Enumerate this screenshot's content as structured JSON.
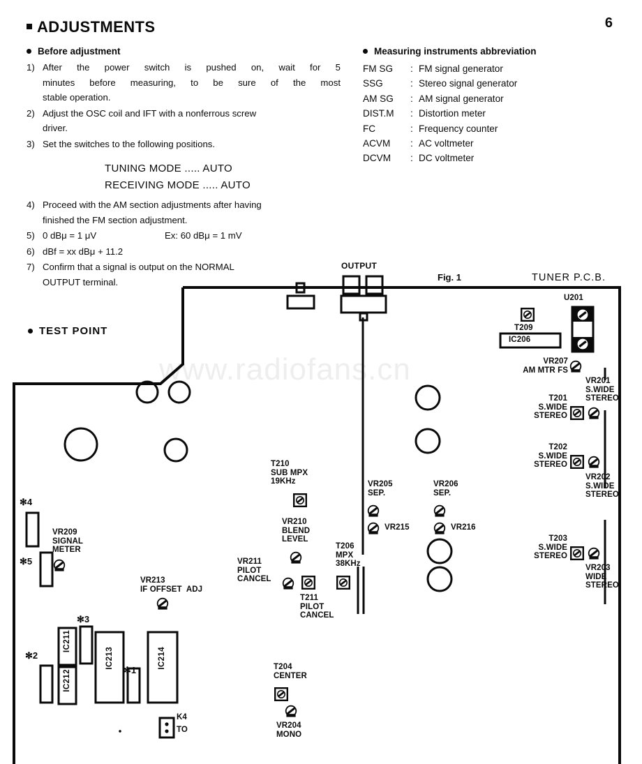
{
  "page": {
    "number": "6"
  },
  "heading": {
    "title": "ADJUSTMENTS"
  },
  "before": {
    "title": "Before adjustment",
    "items": [
      {
        "num": "1)",
        "line1": "After the power switch is pushed on, wait for 5",
        "line2": "minutes before measuring, to be sure of the most",
        "line3": "stable operation."
      },
      {
        "num": "2)",
        "line1": "Adjust the OSC coil and IFT with a nonferrous screw",
        "line2": "driver.",
        "line3": ""
      },
      {
        "num": "3)",
        "line1": "Set the switches to the following positions.",
        "line2": "",
        "line3": ""
      }
    ],
    "modes": [
      "TUNING MODE ..... AUTO",
      "RECEIVING MODE ..... AUTO"
    ],
    "items2": [
      {
        "num": "4)",
        "line1": "Proceed with the AM section adjustments after having",
        "line2": "finished the FM section adjustment."
      },
      {
        "num": "5)",
        "a": "0 dBμ = 1 μV",
        "b": "Ex:  60 dBμ = 1 mV"
      },
      {
        "num": "6)",
        "a": "dBf = xx dBμ + 11.2",
        "b": ""
      },
      {
        "num": "7)",
        "line1": "Confirm  that  a  signal  is  output  on  the  NORMAL",
        "line2": "OUTPUT terminal."
      }
    ]
  },
  "instruments": {
    "title": "Measuring instruments abbreviation",
    "rows": [
      {
        "abbr": "FM SG",
        "colon": ":",
        "desc": "FM signal generator"
      },
      {
        "abbr": "SSG",
        "colon": ":",
        "desc": "Stereo signal generator"
      },
      {
        "abbr": "AM SG",
        "colon": ":",
        "desc": "AM signal generator"
      },
      {
        "abbr": "DIST.M",
        "colon": ":",
        "desc": "Distortion meter"
      },
      {
        "abbr": "FC",
        "colon": ":",
        "desc": "Frequency counter"
      },
      {
        "abbr": "ACVM",
        "colon": ":",
        "desc": "AC voltmeter"
      },
      {
        "abbr": "DCVM",
        "colon": ":",
        "desc": "DC voltmeter"
      }
    ]
  },
  "test_point": {
    "title": "TEST  POINT"
  },
  "watermark": {
    "text": "www.radiofans.cn"
  },
  "diagram": {
    "fig_caption": "Fig. 1",
    "pcb_title": "TUNER P.C.B.",
    "output_label": "OUTPUT",
    "labels": {
      "u201": "U201",
      "t209": "T209",
      "ic206": "IC206",
      "vr207": "VR207\nAM MTR FS",
      "vr201": "VR201\nS.WIDE\nSTEREO",
      "t201": "T201\nS.WIDE\nSTEREO",
      "t202": "T202\nS.WIDE\nSTEREO",
      "vr202": "VR202\nS.WIDE\nSTEREO",
      "t203": "T203\nS.WIDE\nSTEREO",
      "vr203": "VR203\nWIDE\nSTEREO",
      "t210": "T210\nSUB MPX\n19KHz",
      "vr210": "VR210\nBLEND\nLEVEL",
      "vr211": "VR211\nPILOT\nCANCEL",
      "t211": "T211\nPILOT\nCANCEL",
      "vr213": "VR213\nIF OFFSET  ADJ",
      "vr205": "VR205\nSEP.",
      "vr206": "VR206\nSEP.",
      "vr215": "VR215",
      "vr216": "VR216",
      "t206": "T206\nMPX\n38KHz",
      "t204": "T204\nCENTER",
      "vr204": "VR204\nMONO",
      "vr209": "VR209\nSIGNAL\nMETER",
      "k4": "K4",
      "to": "TO",
      "ic211": "IC211",
      "ic212": "IC212",
      "ic213": "IC213",
      "ic214": "IC214",
      "hash1": "✻1",
      "hash2": "✻2",
      "hash3": "✻3",
      "hash4": "✻4",
      "hash5": "✻5"
    }
  },
  "colors": {
    "ink": "#0a0a0a",
    "watermark": "#eeeeee",
    "paper": "#ffffff"
  }
}
